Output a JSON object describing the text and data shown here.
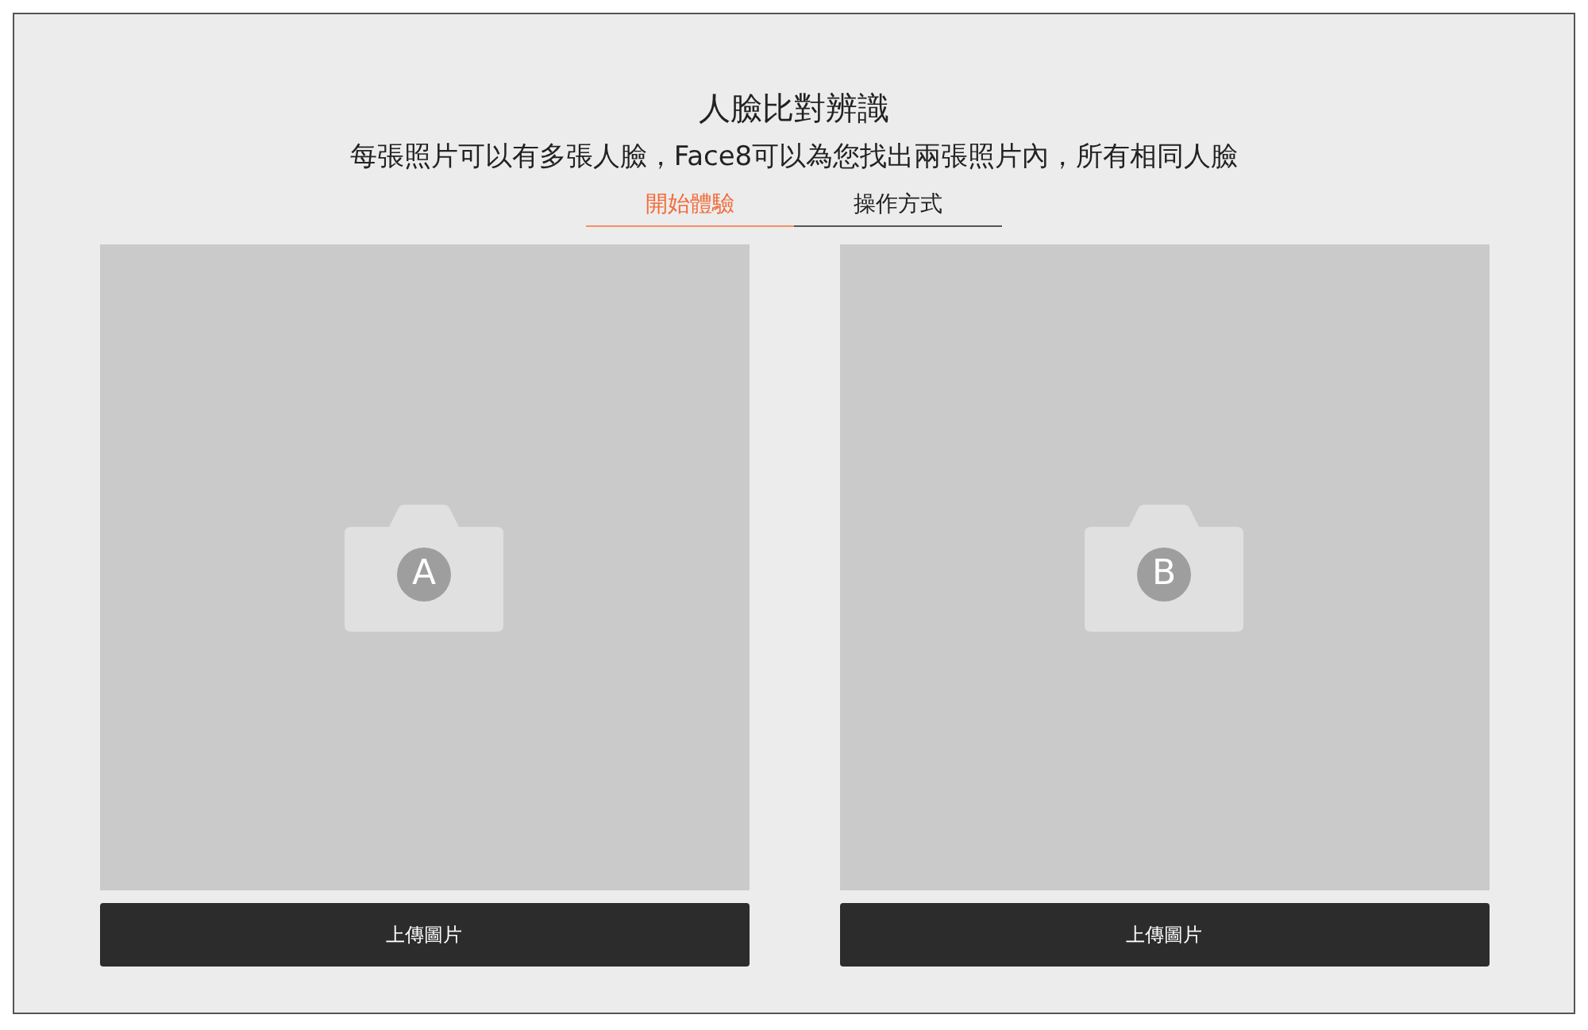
{
  "title": "人臉比對辨識",
  "subtitle": "每張照片可以有多張人臉，Face8可以為您找出兩張照片內，所有相同人臉",
  "tabs": [
    {
      "label": "開始體驗",
      "selected": true
    },
    {
      "label": "操作方式",
      "selected": false
    }
  ],
  "uploads": [
    {
      "letter": "A",
      "button": "上傳圖片"
    },
    {
      "letter": "B",
      "button": "上傳圖片"
    }
  ]
}
